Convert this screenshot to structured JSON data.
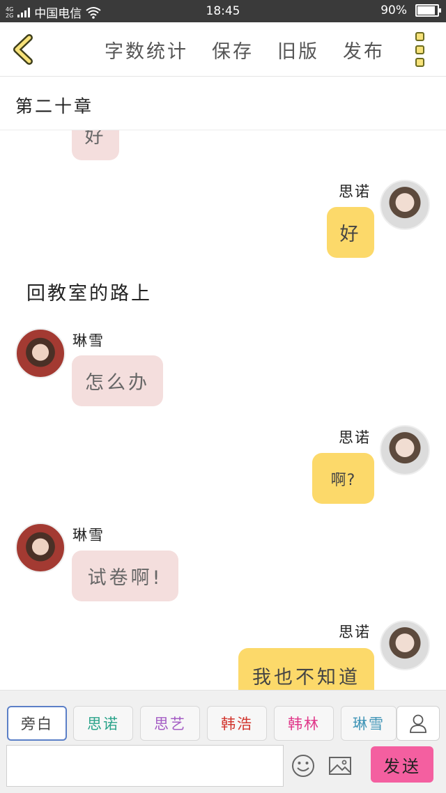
{
  "status_bar": {
    "net_top": "4G",
    "net_bottom": "2G",
    "carrier": "中国电信",
    "time": "18:45",
    "battery": "90%",
    "battery_level": 0.9
  },
  "toolbar": {
    "word_count": "字数统计",
    "save": "保存",
    "old_version": "旧版",
    "publish": "发布"
  },
  "chapter": {
    "title": "第二十章"
  },
  "messages": [
    {
      "side": "left",
      "text": "好"
    },
    {
      "side": "right",
      "name": "思诺",
      "text": "好"
    },
    {
      "type": "narration",
      "text": "回教室的路上"
    },
    {
      "side": "left",
      "name": "琳雪",
      "text": "怎么办"
    },
    {
      "side": "right",
      "name": "思诺",
      "text": "啊?"
    },
    {
      "side": "left",
      "name": "琳雪",
      "text": "试卷啊!"
    },
    {
      "side": "right",
      "name": "思诺",
      "text": "我也不知道"
    }
  ],
  "characters": [
    {
      "label": "旁白",
      "color": "#444444"
    },
    {
      "label": "思诺",
      "color": "#2aa38a"
    },
    {
      "label": "思艺",
      "color": "#a45cc4"
    },
    {
      "label": "韩浩",
      "color": "#d2352e"
    },
    {
      "label": "韩林",
      "color": "#e0388a"
    },
    {
      "label": "琳雪",
      "color": "#3f94b6"
    }
  ],
  "composer": {
    "input_value": "",
    "send": "发送"
  },
  "colors": {
    "accent_yellow": "#fcd96a",
    "bubble_pink": "#f4dedd",
    "send_pink": "#f45fa0",
    "status_bar": "#3a3a3a"
  }
}
